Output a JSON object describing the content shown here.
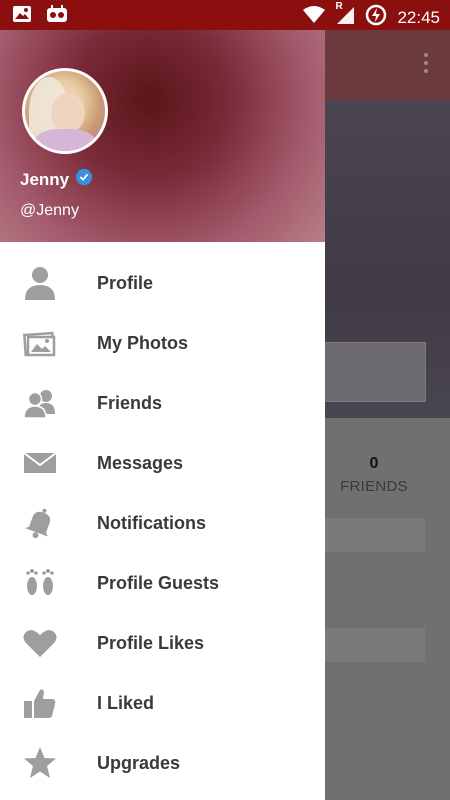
{
  "status_bar": {
    "time": "22:45",
    "icons": [
      "image-icon",
      "robot-notification-icon",
      "wifi-icon",
      "signal-icon",
      "battery-charging-icon"
    ],
    "signal_badge": "R"
  },
  "drawer": {
    "header": {
      "name": "Jenny",
      "handle": "@Jenny",
      "verified": true
    },
    "items": [
      {
        "label": "Profile",
        "icon": "person-icon"
      },
      {
        "label": "My Photos",
        "icon": "photos-icon"
      },
      {
        "label": "Friends",
        "icon": "friends-icon"
      },
      {
        "label": "Messages",
        "icon": "envelope-icon"
      },
      {
        "label": "Notifications",
        "icon": "bell-icon"
      },
      {
        "label": "Profile Guests",
        "icon": "footprints-icon"
      },
      {
        "label": "Profile Likes",
        "icon": "heart-icon"
      },
      {
        "label": "I Liked",
        "icon": "thumbs-up-icon"
      },
      {
        "label": "Upgrades",
        "icon": "star-icon"
      }
    ]
  },
  "background": {
    "friends_count": "0",
    "friends_label": "FRIENDS"
  },
  "colors": {
    "status_bar": "#8c0f0f",
    "icon_gray": "#9e9e9e",
    "label_text": "#3a3a3a",
    "verified_blue": "#3b8fe0"
  }
}
